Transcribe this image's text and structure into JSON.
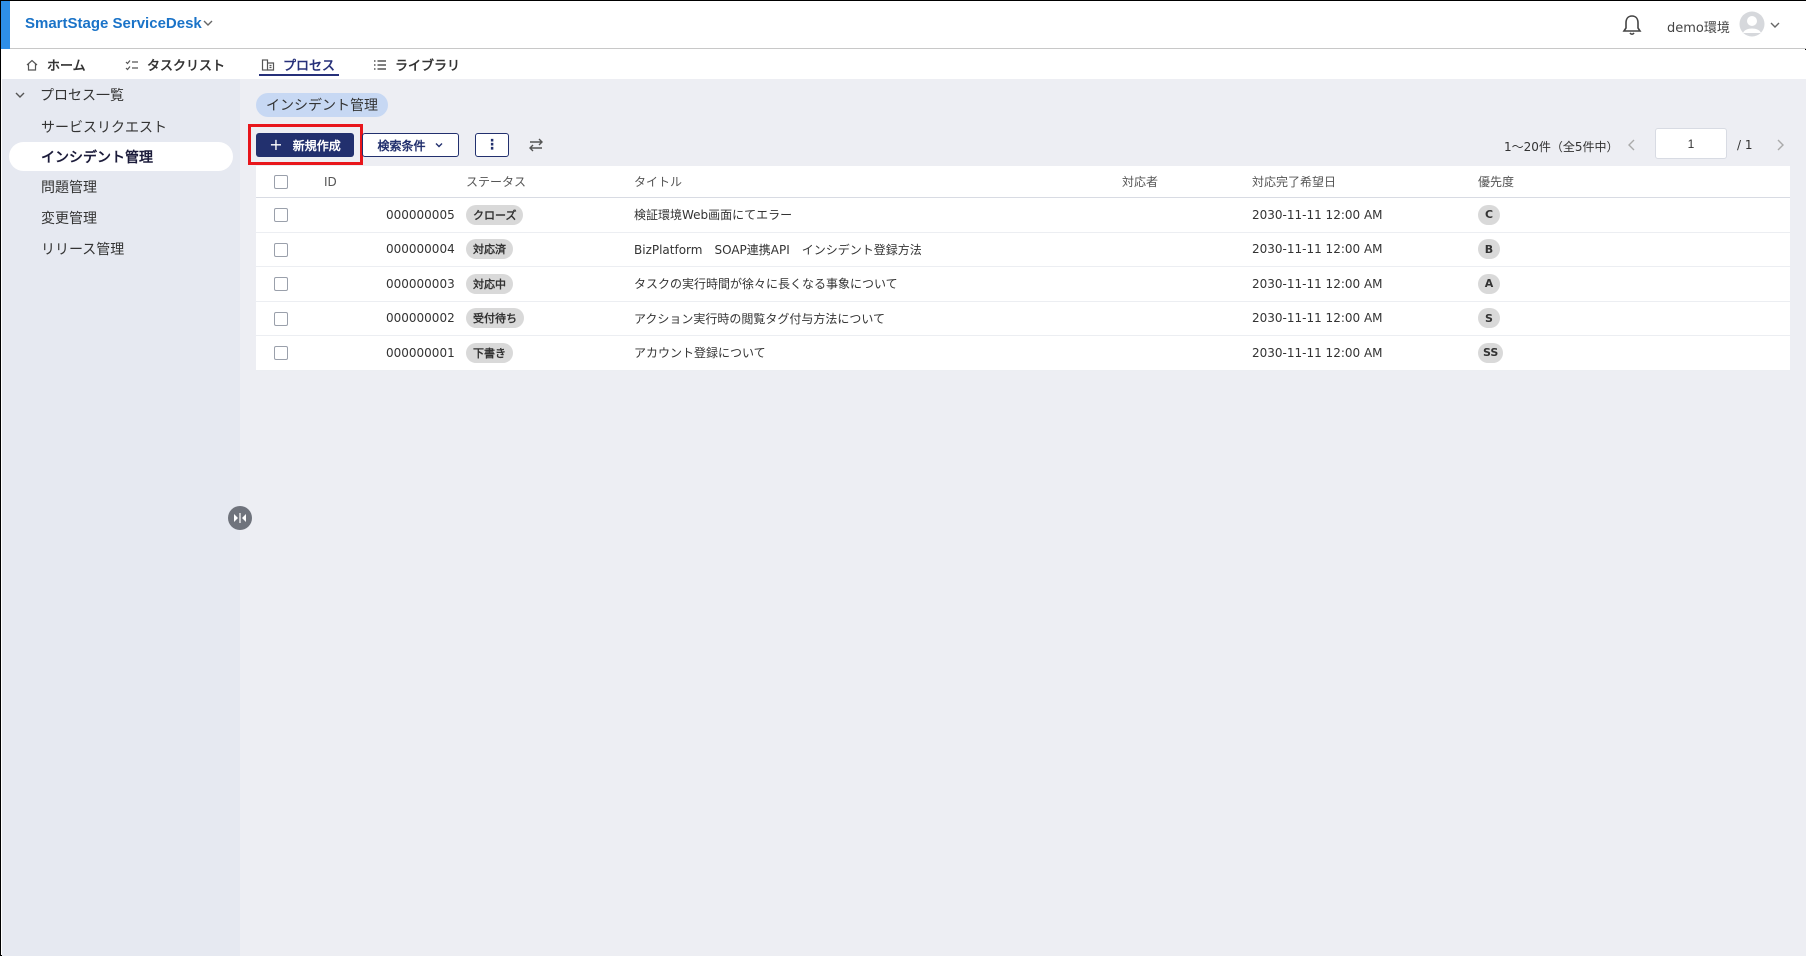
{
  "header": {
    "app_title": "SmartStage ServiceDesk",
    "environment": "demo環境",
    "accent_color": "#2e8fe8",
    "icons": [
      "chevron-down-icon",
      "bell-icon",
      "user-avatar-icon"
    ]
  },
  "nav": {
    "tabs": [
      {
        "label": "ホーム",
        "icon": "home-icon"
      },
      {
        "label": "タスクリスト",
        "icon": "checklist-icon"
      },
      {
        "label": "プロセス",
        "icon": "process-icon",
        "active": true
      },
      {
        "label": "ライブラリ",
        "icon": "list-icon"
      }
    ]
  },
  "sidebar": {
    "header": "プロセス一覧",
    "items": [
      {
        "label": "サービスリクエスト"
      },
      {
        "label": "インシデント管理",
        "active": true
      },
      {
        "label": "問題管理"
      },
      {
        "label": "変更管理"
      },
      {
        "label": "リリース管理"
      }
    ]
  },
  "main": {
    "breadcrumb": "インシデント管理",
    "toolbar": {
      "new_label": "新規作成",
      "search_label": "検索条件",
      "more_label": "⋮"
    },
    "pager": {
      "info": "1〜20件（全5件中）",
      "page": "1",
      "total": "/ 1"
    },
    "table": {
      "headers": {
        "id": "ID",
        "status": "ステータス",
        "title": "タイトル",
        "assignee": "対応者",
        "due": "対応完了希望日",
        "priority": "優先度"
      },
      "rows": [
        {
          "id": "000000005",
          "status": "クローズ",
          "title": "検証環境Web画面にてエラー",
          "assignee": "",
          "due": "2030-11-11 12:00 AM",
          "priority": "C"
        },
        {
          "id": "000000004",
          "status": "対応済",
          "title": "BizPlatform　SOAP連携API　インシデント登録方法",
          "assignee": "",
          "due": "2030-11-11 12:00 AM",
          "priority": "B"
        },
        {
          "id": "000000003",
          "status": "対応中",
          "title": "タスクの実行時間が徐々に長くなる事象について",
          "assignee": "",
          "due": "2030-11-11 12:00 AM",
          "priority": "A"
        },
        {
          "id": "000000002",
          "status": "受付待ち",
          "title": "アクション実行時の閲覧タグ付与方法について",
          "assignee": "",
          "due": "2030-11-11 12:00 AM",
          "priority": "S"
        },
        {
          "id": "000000001",
          "status": "下書き",
          "title": "アカウント登録について",
          "assignee": "",
          "due": "2030-11-11 12:00 AM",
          "priority": "SS"
        }
      ]
    }
  },
  "colors": {
    "primary": "#22306e",
    "highlight": "#e8161b",
    "sidebar_bg": "#e6e9f1",
    "main_bg": "#edeef3"
  }
}
